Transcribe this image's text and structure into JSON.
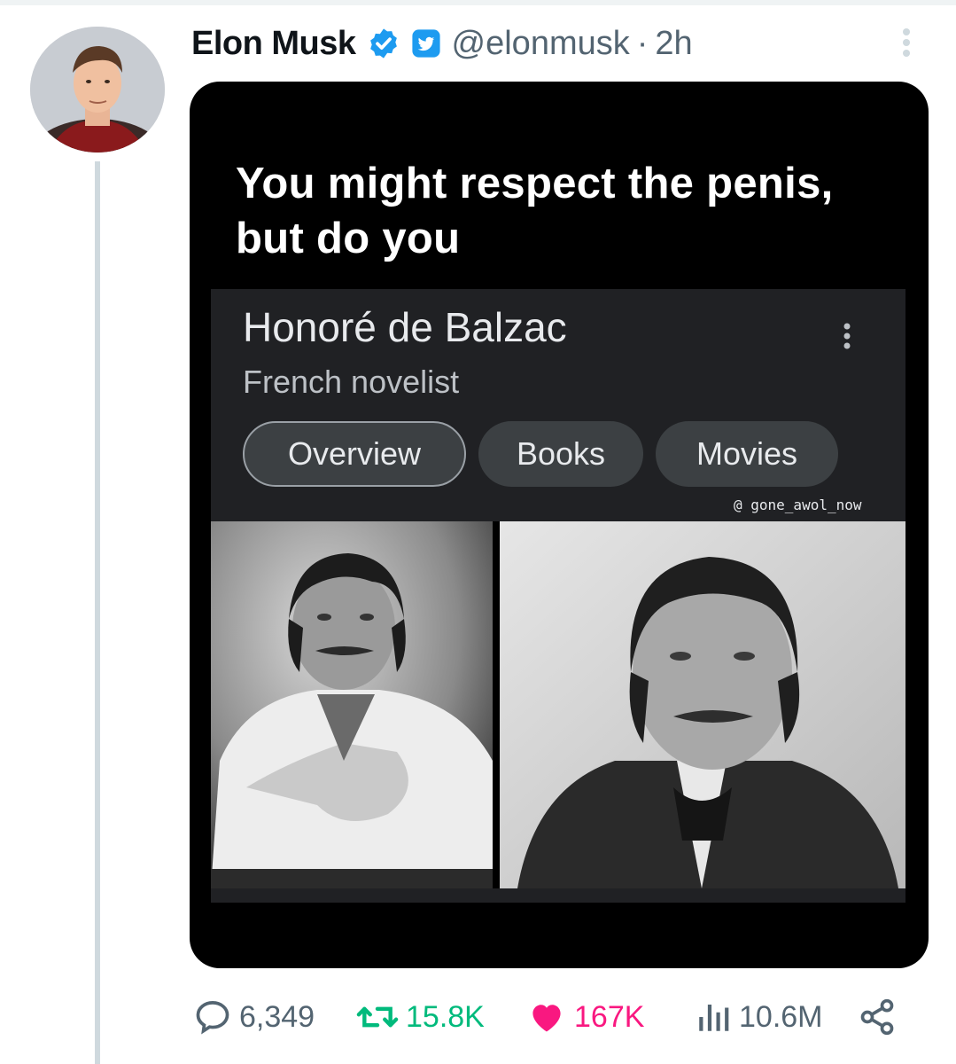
{
  "tweet": {
    "author_name": "Elon Musk",
    "handle": "@elonmusk",
    "separator": "·",
    "time": "2h",
    "icons": {
      "verified": "verified-badge-icon",
      "affiliation": "twitter-affiliate-badge-icon",
      "more": "more-vertical-icon"
    },
    "colors": {
      "verified_blue": "#1d9bf0",
      "retweet_green": "#00ba7c",
      "like_pink": "#f91880",
      "muted": "#536471"
    }
  },
  "media": {
    "caption": "You might respect the penis, but do you",
    "knowledge_panel": {
      "title": "Honoré de Balzac",
      "subtitle": "French novelist",
      "chips": [
        "Overview",
        "Books",
        "Movies"
      ],
      "active_chip": "Overview"
    },
    "watermark": "@ gone_awol_now"
  },
  "actions": {
    "replies": "6,349",
    "retweets": "15.8K",
    "likes": "167K",
    "views": "10.6M",
    "liked": true
  }
}
